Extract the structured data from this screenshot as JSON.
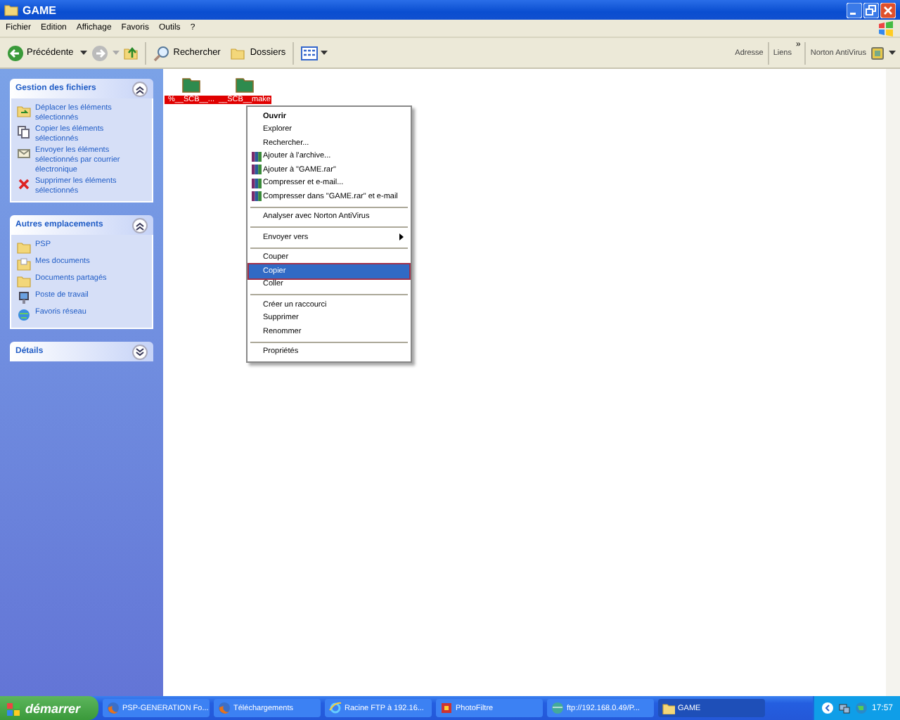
{
  "window": {
    "title": "GAME"
  },
  "menu_bar": [
    "Fichier",
    "Edition",
    "Affichage",
    "Favoris",
    "Outils",
    "?"
  ],
  "toolbar": {
    "back": "Précédente",
    "search": "Rechercher",
    "folders": "Dossiers",
    "address_label": "Adresse",
    "links_label": "Liens",
    "links_more": "»",
    "norton": "Norton AntiVirus"
  },
  "panels": [
    {
      "title": "Gestion des fichiers",
      "expanded": true,
      "items": [
        {
          "label": "Déplacer les éléments sélectionnés",
          "kind": "move"
        },
        {
          "label": "Copier les éléments sélectionnés",
          "kind": "copy"
        },
        {
          "label": "Envoyer les éléments sélectionnés par courrier électronique",
          "kind": "mail"
        },
        {
          "label": "Supprimer les éléments sélectionnés",
          "kind": "delete"
        }
      ]
    },
    {
      "title": "Autres emplacements",
      "expanded": true,
      "items": [
        {
          "label": "PSP",
          "kind": "folder"
        },
        {
          "label": "Mes documents",
          "kind": "documents"
        },
        {
          "label": "Documents partagés",
          "kind": "folder"
        },
        {
          "label": "Poste de travail",
          "kind": "computer"
        },
        {
          "label": "Favoris réseau",
          "kind": "network"
        }
      ]
    },
    {
      "title": "Détails",
      "expanded": false
    }
  ],
  "files": [
    {
      "name": "%__SCB__...",
      "selected": true
    },
    {
      "name": "__SCB__make",
      "selected": true
    }
  ],
  "context_menu": [
    {
      "kind": "default",
      "label": "Ouvrir",
      "selected": false
    },
    {
      "kind": "plain",
      "label": "Explorer",
      "selected": false
    },
    {
      "kind": "plain",
      "label": "Rechercher...",
      "selected": false
    },
    {
      "kind": "archive",
      "label": "Ajouter à l'archive...",
      "selected": false
    },
    {
      "kind": "archive",
      "label": "Ajouter à \"GAME.rar\"",
      "selected": false
    },
    {
      "kind": "archive",
      "label": "Compresser et e-mail...",
      "selected": false
    },
    {
      "kind": "archive",
      "label": "Compresser dans \"GAME.rar\" et e-mail",
      "selected": false
    },
    {
      "kind": "separator"
    },
    {
      "kind": "plain",
      "label": "Analyser avec Norton AntiVirus",
      "selected": false
    },
    {
      "kind": "separator"
    },
    {
      "kind": "submenu",
      "label": "Envoyer vers",
      "selected": false
    },
    {
      "kind": "separator"
    },
    {
      "kind": "plain",
      "label": "Couper",
      "selected": false
    },
    {
      "kind": "plain",
      "label": "Copier",
      "selected": true
    },
    {
      "kind": "plain",
      "label": "Coller",
      "selected": false
    },
    {
      "kind": "separator"
    },
    {
      "kind": "plain",
      "label": "Créer un raccourci",
      "selected": false
    },
    {
      "kind": "plain",
      "label": "Supprimer",
      "selected": false
    },
    {
      "kind": "plain",
      "label": "Renommer",
      "selected": false
    },
    {
      "kind": "separator"
    },
    {
      "kind": "plain",
      "label": "Propriétés",
      "selected": false
    }
  ],
  "taskbar": {
    "start": "démarrer",
    "buttons": [
      {
        "label": "PSP-GENERATION Fo...",
        "kind": "firefox",
        "selected": false
      },
      {
        "label": "Téléchargements",
        "kind": "firefox",
        "selected": false
      },
      {
        "label": "Racine FTP à 192.16...",
        "kind": "ie",
        "selected": false
      },
      {
        "label": "PhotoFiltre",
        "kind": "photofiltre",
        "selected": false
      },
      {
        "label": "ftp://192.168.0.49/P...",
        "kind": "ftp",
        "selected": false
      },
      {
        "label": "GAME",
        "kind": "folder",
        "selected": true
      }
    ],
    "clock": "17:57"
  }
}
